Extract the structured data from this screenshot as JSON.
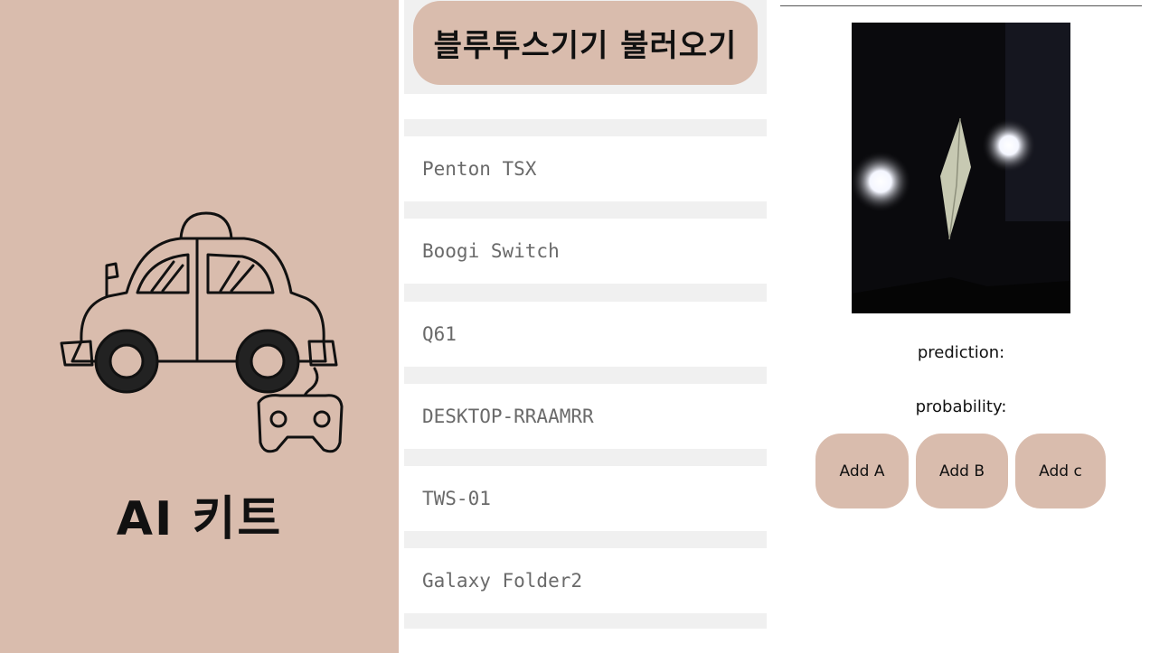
{
  "left": {
    "title": "AI 키트"
  },
  "load_button_label": "블루투스기기 불러오기",
  "devices": [
    "Penton TSX",
    "Boogi Switch",
    "Q61",
    "DESKTOP-RRAAMRR",
    "TWS-01",
    "Galaxy Folder2"
  ],
  "prediction_label": "prediction:",
  "probability_label": "probability:",
  "buttons": {
    "add_a": "Add A",
    "add_b": "Add B",
    "add_c": "Add c"
  },
  "colors": {
    "accent": "#d9bcad",
    "list_gap": "#f0f0f0",
    "device_text": "#6a6a6a"
  }
}
